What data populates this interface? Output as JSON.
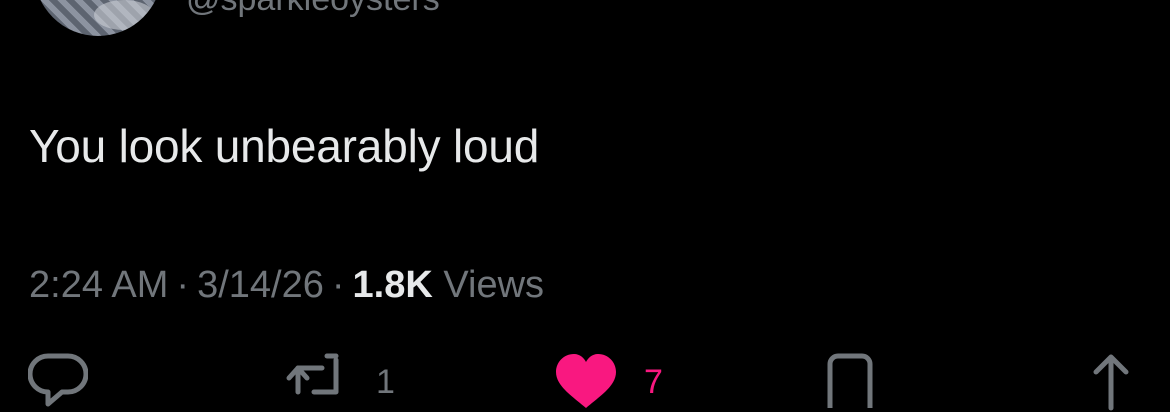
{
  "tweet": {
    "handle": "@sparkleoysters",
    "text": "You look unbearably loud",
    "time": "2:24 AM",
    "separator": "·",
    "date": "3/14/26",
    "views_count": "1.8K",
    "views_label": "Views"
  },
  "actions": {
    "reply": {
      "icon": "reply-icon"
    },
    "retweet": {
      "icon": "retweet-icon",
      "count": "1"
    },
    "like": {
      "icon": "heart-icon",
      "count": "7",
      "color": "#f91880"
    },
    "bookmark": {
      "icon": "bookmark-icon"
    },
    "share": {
      "icon": "share-icon"
    }
  },
  "colors": {
    "background": "#000000",
    "primary_text": "#e7e9ea",
    "secondary_text": "#71767b",
    "like": "#f91880"
  }
}
